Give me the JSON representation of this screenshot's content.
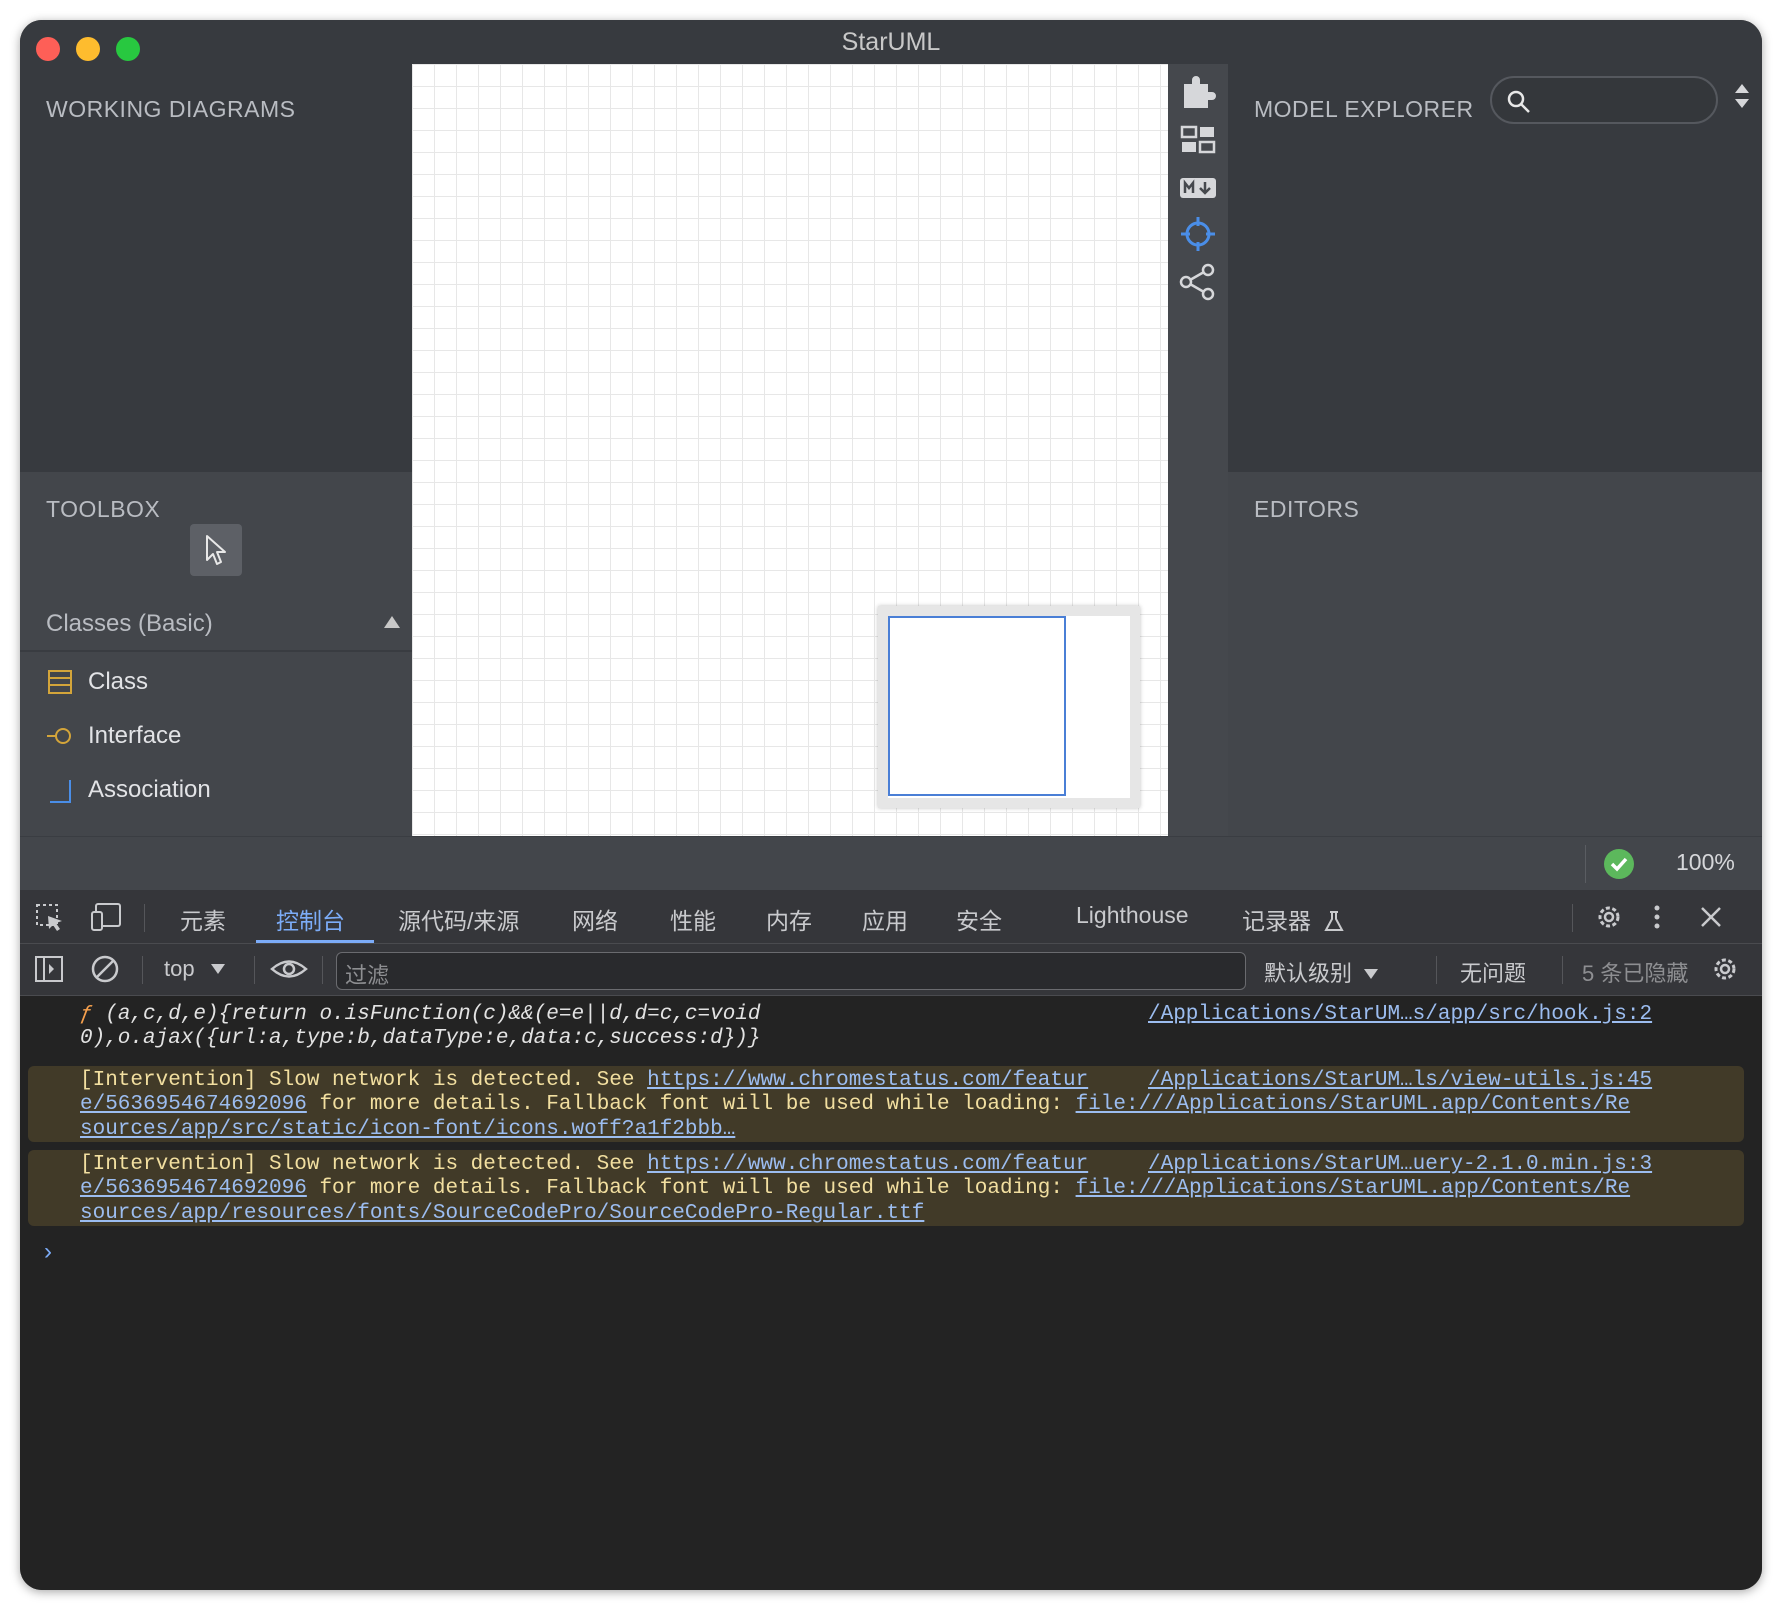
{
  "window": {
    "title": "StarUML"
  },
  "working_diagrams": {
    "title": "WORKING DIAGRAMS"
  },
  "toolbox": {
    "title": "TOOLBOX",
    "group": "Classes (Basic)",
    "items": [
      {
        "label": "Class",
        "icon": "class-icon"
      },
      {
        "label": "Interface",
        "icon": "interface-icon"
      },
      {
        "label": "Association",
        "icon": "association-icon"
      }
    ]
  },
  "model_explorer": {
    "title": "MODEL EXPLORER",
    "search_placeholder": ""
  },
  "editors": {
    "title": "EDITORS"
  },
  "status": {
    "zoom": "100%"
  },
  "devtools": {
    "tabs": [
      "元素",
      "控制台",
      "源代码/来源",
      "网络",
      "性能",
      "内存",
      "应用",
      "安全",
      "Lighthouse",
      "记录器"
    ],
    "active_tab": "控制台",
    "context": "top",
    "filter_placeholder": "过滤",
    "level": "默认级别",
    "issues": "无问题",
    "hidden": "5 条已隐藏"
  },
  "console": {
    "messages": [
      {
        "type": "log",
        "prefix": "ƒ",
        "lines": [
          "(a,c,d,e){return o.isFunction(c)&&(e=e||d,d=c,c=void",
          "0),o.ajax({url:a,type:b,dataType:e,data:c,success:d})}"
        ],
        "source": "/Applications/StarUM…s/app/src/hook.js:2"
      },
      {
        "type": "warning",
        "line1_text": "[Intervention] Slow network is detected. See ",
        "line1_link": "https://www.chromestatus.com/featur",
        "line2_link": "e/5636954674692096",
        "line2_text": " for more details. Fallback font will be used while loading: ",
        "line2_link2": "file:///Applications/StarUML.app/Contents/Re",
        "line3_link": "sources/app/src/static/icon-font/icons.woff?a1f2bbb…",
        "source": "/Applications/StarUM…ls/view-utils.js:45"
      },
      {
        "type": "warning",
        "line1_text": "[Intervention] Slow network is detected. See ",
        "line1_link": "https://www.chromestatus.com/featur",
        "line2_link": "e/5636954674692096",
        "line2_text": " for more details. Fallback font will be used while loading: ",
        "line2_link2": "file:///Applications/StarUML.app/Contents/Re",
        "line3_link": "sources/app/resources/fonts/SourceCodePro/SourceCodePro-Regular.ttf",
        "source": "/Applications/StarUM…uery-2.1.0.min.js:3"
      }
    ],
    "prompt": "›"
  }
}
